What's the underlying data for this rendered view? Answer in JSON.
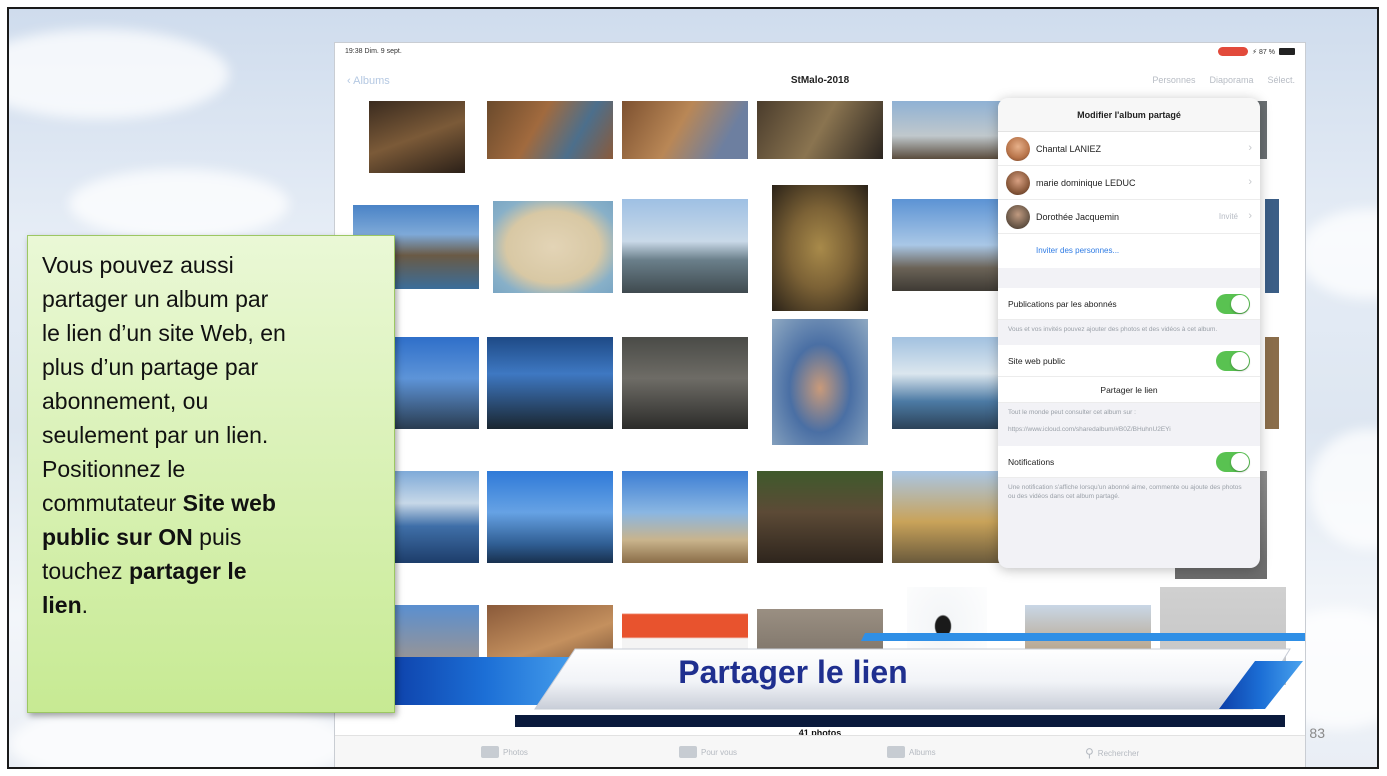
{
  "ipad": {
    "status_time": "19:38  Dim. 9 sept.",
    "status_right": "⚡ 87 %",
    "back_label": "Albums",
    "title": "StMalo-2018",
    "nav_actions": [
      "Personnes",
      "Diaporama",
      "Sélect."
    ],
    "photo_count": "41 photos",
    "tabs": [
      {
        "label": "Photos",
        "icon": "photos-icon"
      },
      {
        "label": "Pour vous",
        "icon": "for-you-icon"
      },
      {
        "label": "Albums",
        "icon": "albums-icon"
      },
      {
        "label": "Rechercher",
        "icon": "search-icon"
      }
    ]
  },
  "popover": {
    "title": "Modifier l'album partagé",
    "members": [
      {
        "name": "Chantal LANIEZ",
        "status": "",
        "avatar_color": "#b8744a"
      },
      {
        "name": "marie dominique LEDUC",
        "status": "",
        "avatar_color": "#8b5a3c"
      },
      {
        "name": "Dorothée Jacquemin",
        "status": "Invité",
        "avatar_color": "#6d5a4a"
      }
    ],
    "invite_label": "Inviter des personnes...",
    "subscribers_label": "Publications par les abonnés",
    "subscribers_help": "Vous et vos invités pouvez ajouter des photos et des vidéos à cet album.",
    "public_site_label": "Site web public",
    "share_link_label": "Partager le lien",
    "public_help": "Tout le monde peut consulter cet album sur :",
    "public_url": "https://www.icloud.com/sharedalbum/#B0Z/BHuhnU2EYi",
    "notifications_label": "Notifications",
    "notifications_help": "Une notification s'affiche lorsqu'un abonné aime, commente ou ajoute des photos ou des vidéos dans cet album partagé.",
    "toggle_color": "#59c251"
  },
  "callout": {
    "line1": "Vous pouvez aussi",
    "line2": "partager un album par",
    "line3": "le lien d’un site Web, en",
    "line4": "plus d’un partage par",
    "line5": "abonnement, ou",
    "line6": "seulement par un lien.",
    "line7": "Positionnez le",
    "line8_pre": "commutateur ",
    "line8_bold": "Site web",
    "line9_bold": "public sur ON",
    "line9_post": " puis",
    "line10_pre": "touchez  ",
    "line10_bold": "partager le",
    "line11_bold": "lien",
    "line11_post": "."
  },
  "banner": {
    "text": "Partager le lien",
    "text_color": "#1f2f8f",
    "accent_color": "#1c6fd6"
  },
  "slide_number": "83"
}
